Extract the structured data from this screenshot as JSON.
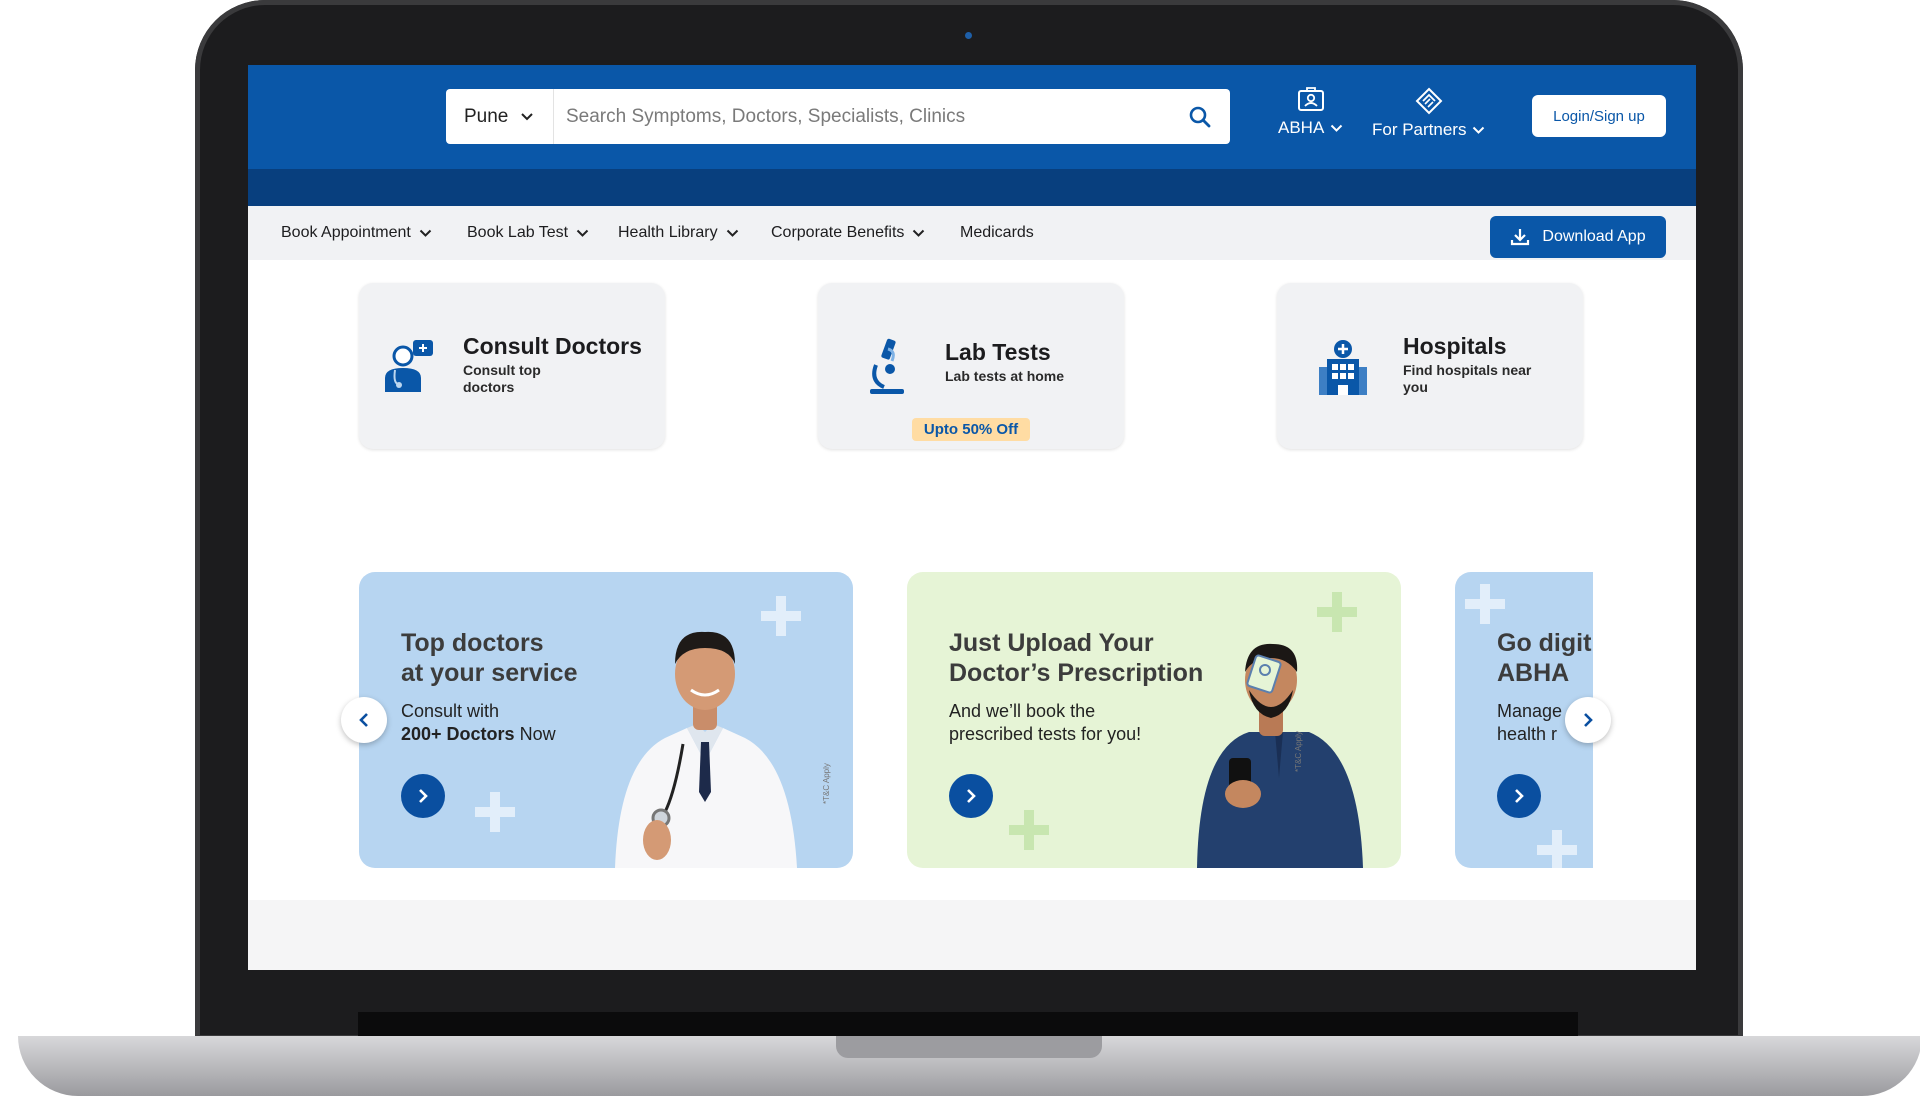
{
  "header": {
    "city": "Pune",
    "search_placeholder": "Search Symptoms, Doctors, Specialists, Clinics",
    "abha_label": "ABHA",
    "partners_label": "For Partners",
    "login_label": "Login/Sign up"
  },
  "menu": {
    "items": [
      {
        "label": "Book Appointment",
        "dropdown": true
      },
      {
        "label": "Book Lab Test",
        "dropdown": true
      },
      {
        "label": "Health Library",
        "dropdown": true
      },
      {
        "label": "Corporate Benefits",
        "dropdown": true
      },
      {
        "label": "Medicards",
        "dropdown": false
      }
    ],
    "download_label": "Download App"
  },
  "services": [
    {
      "title": "Consult Doctors",
      "subtitle_line1": "Consult top",
      "subtitle_line2": "doctors",
      "icon": "doctor-icon"
    },
    {
      "title": "Lab Tests",
      "subtitle_line1": "Lab tests at home",
      "offer": "Upto 50% Off",
      "icon": "microscope-icon"
    },
    {
      "title": "Hospitals",
      "subtitle_line1": "Find hospitals near",
      "subtitle_line2": "you",
      "icon": "hospital-icon"
    }
  ],
  "banners": [
    {
      "title_line1": "Top doctors",
      "title_line2": "at your service",
      "text_line1": "Consult with",
      "text_bold": "200+ Doctors",
      "text_rest": " Now",
      "tc": "*T&C Apply"
    },
    {
      "title_line1": "Just Upload Your",
      "title_line2": "Doctor’s Prescription",
      "text_line1": "And we’ll book the",
      "text_line2": "prescribed tests for you!",
      "tc": "*T&C Apply"
    },
    {
      "title_line1": "Go digit",
      "title_line2": "ABHA",
      "text_line1": "Manage",
      "text_line2": "health r"
    }
  ],
  "colors": {
    "brand_blue": "#0a57a8",
    "dark_blue": "#083f7e",
    "banner_blue": "#b7d5f1",
    "banner_green": "#e6f4d6",
    "offer_bg": "#ffdca3"
  }
}
